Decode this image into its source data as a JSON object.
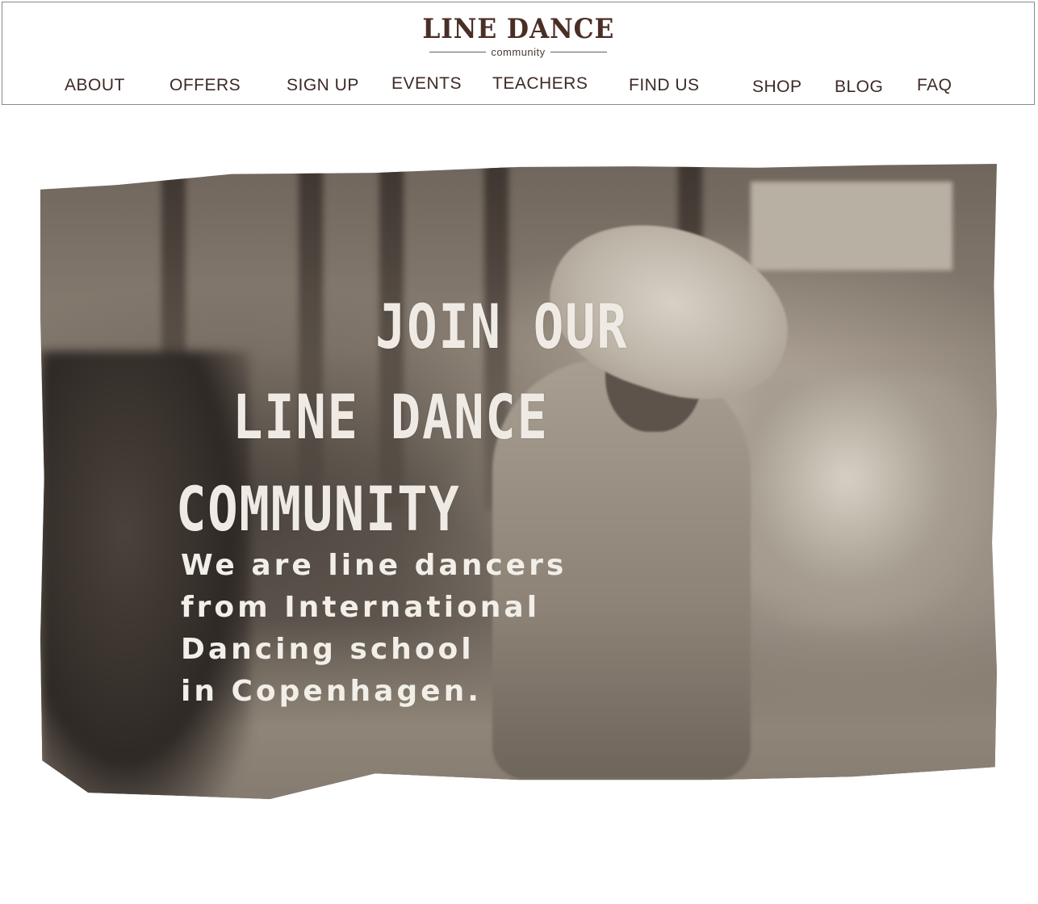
{
  "logo": {
    "title": "LINE DANCE",
    "subtitle": "community"
  },
  "nav": {
    "items": [
      {
        "label": "ABOUT"
      },
      {
        "label": "OFFERS"
      },
      {
        "label": "SIGN UP"
      },
      {
        "label": "EVENTS"
      },
      {
        "label": "TEACHERS"
      },
      {
        "label": "FIND US"
      },
      {
        "label": "SHOP"
      },
      {
        "label": "BLOG"
      },
      {
        "label": "FAQ"
      }
    ]
  },
  "hero": {
    "headline": [
      "JOIN OUR",
      "LINE DANCE",
      "COMMUNITY"
    ],
    "tagline": [
      "We are line dancers",
      "from International",
      "Dancing school",
      "in Copenhagen."
    ]
  },
  "colors": {
    "brand": "#4a2e26",
    "nav_text": "#3d2a25",
    "hero_text": "#efeae4",
    "border": "#8a8a8a"
  }
}
